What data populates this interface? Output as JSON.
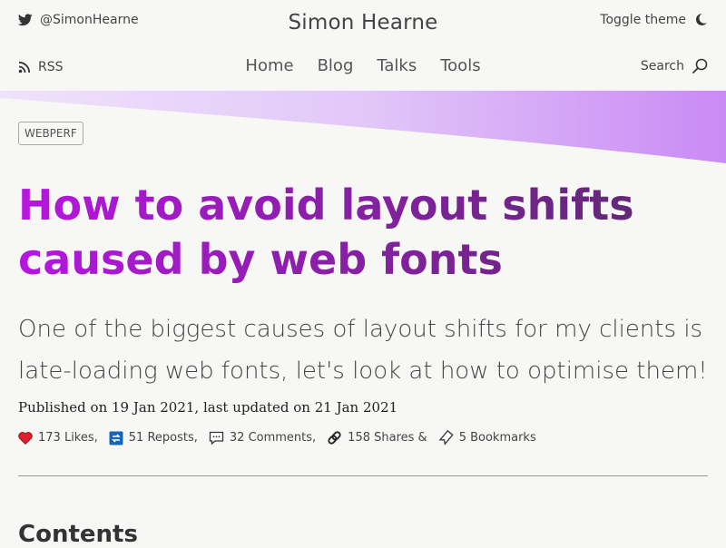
{
  "header": {
    "twitter_handle": "@SimonHearne",
    "site_title": "Simon Hearne",
    "toggle_label": "Toggle theme",
    "rss_label": "RSS",
    "search_label": "Search",
    "nav": [
      "Home",
      "Blog",
      "Talks",
      "Tools"
    ]
  },
  "article": {
    "tag": "WEBPERF",
    "title": "How to avoid layout shifts caused by web fonts",
    "subtitle": "One of the biggest causes of layout shifts for my clients is late-loading web fonts, let's look at how to optimise them!",
    "published": "Published on 19 Jan 2021, last updated on 21 Jan 2021",
    "stats": {
      "likes": "173 Likes,",
      "reposts": "51 Reposts,",
      "comments": "32 Comments,",
      "shares": "158 Shares &",
      "bookmarks": "5 Bookmarks"
    },
    "contents_heading": "Contents"
  },
  "colors": {
    "title_gradient_start": "#b716e0",
    "title_gradient_end": "#5b2a6e",
    "wave": "#c98af5",
    "like_heart": "#e0202a",
    "repost": "#1565c0"
  },
  "icons": [
    "twitter-icon",
    "moon-icon",
    "rss-icon",
    "search-icon",
    "heart-icon",
    "repost-icon",
    "comment-icon",
    "link-icon",
    "bookmark-icon"
  ]
}
